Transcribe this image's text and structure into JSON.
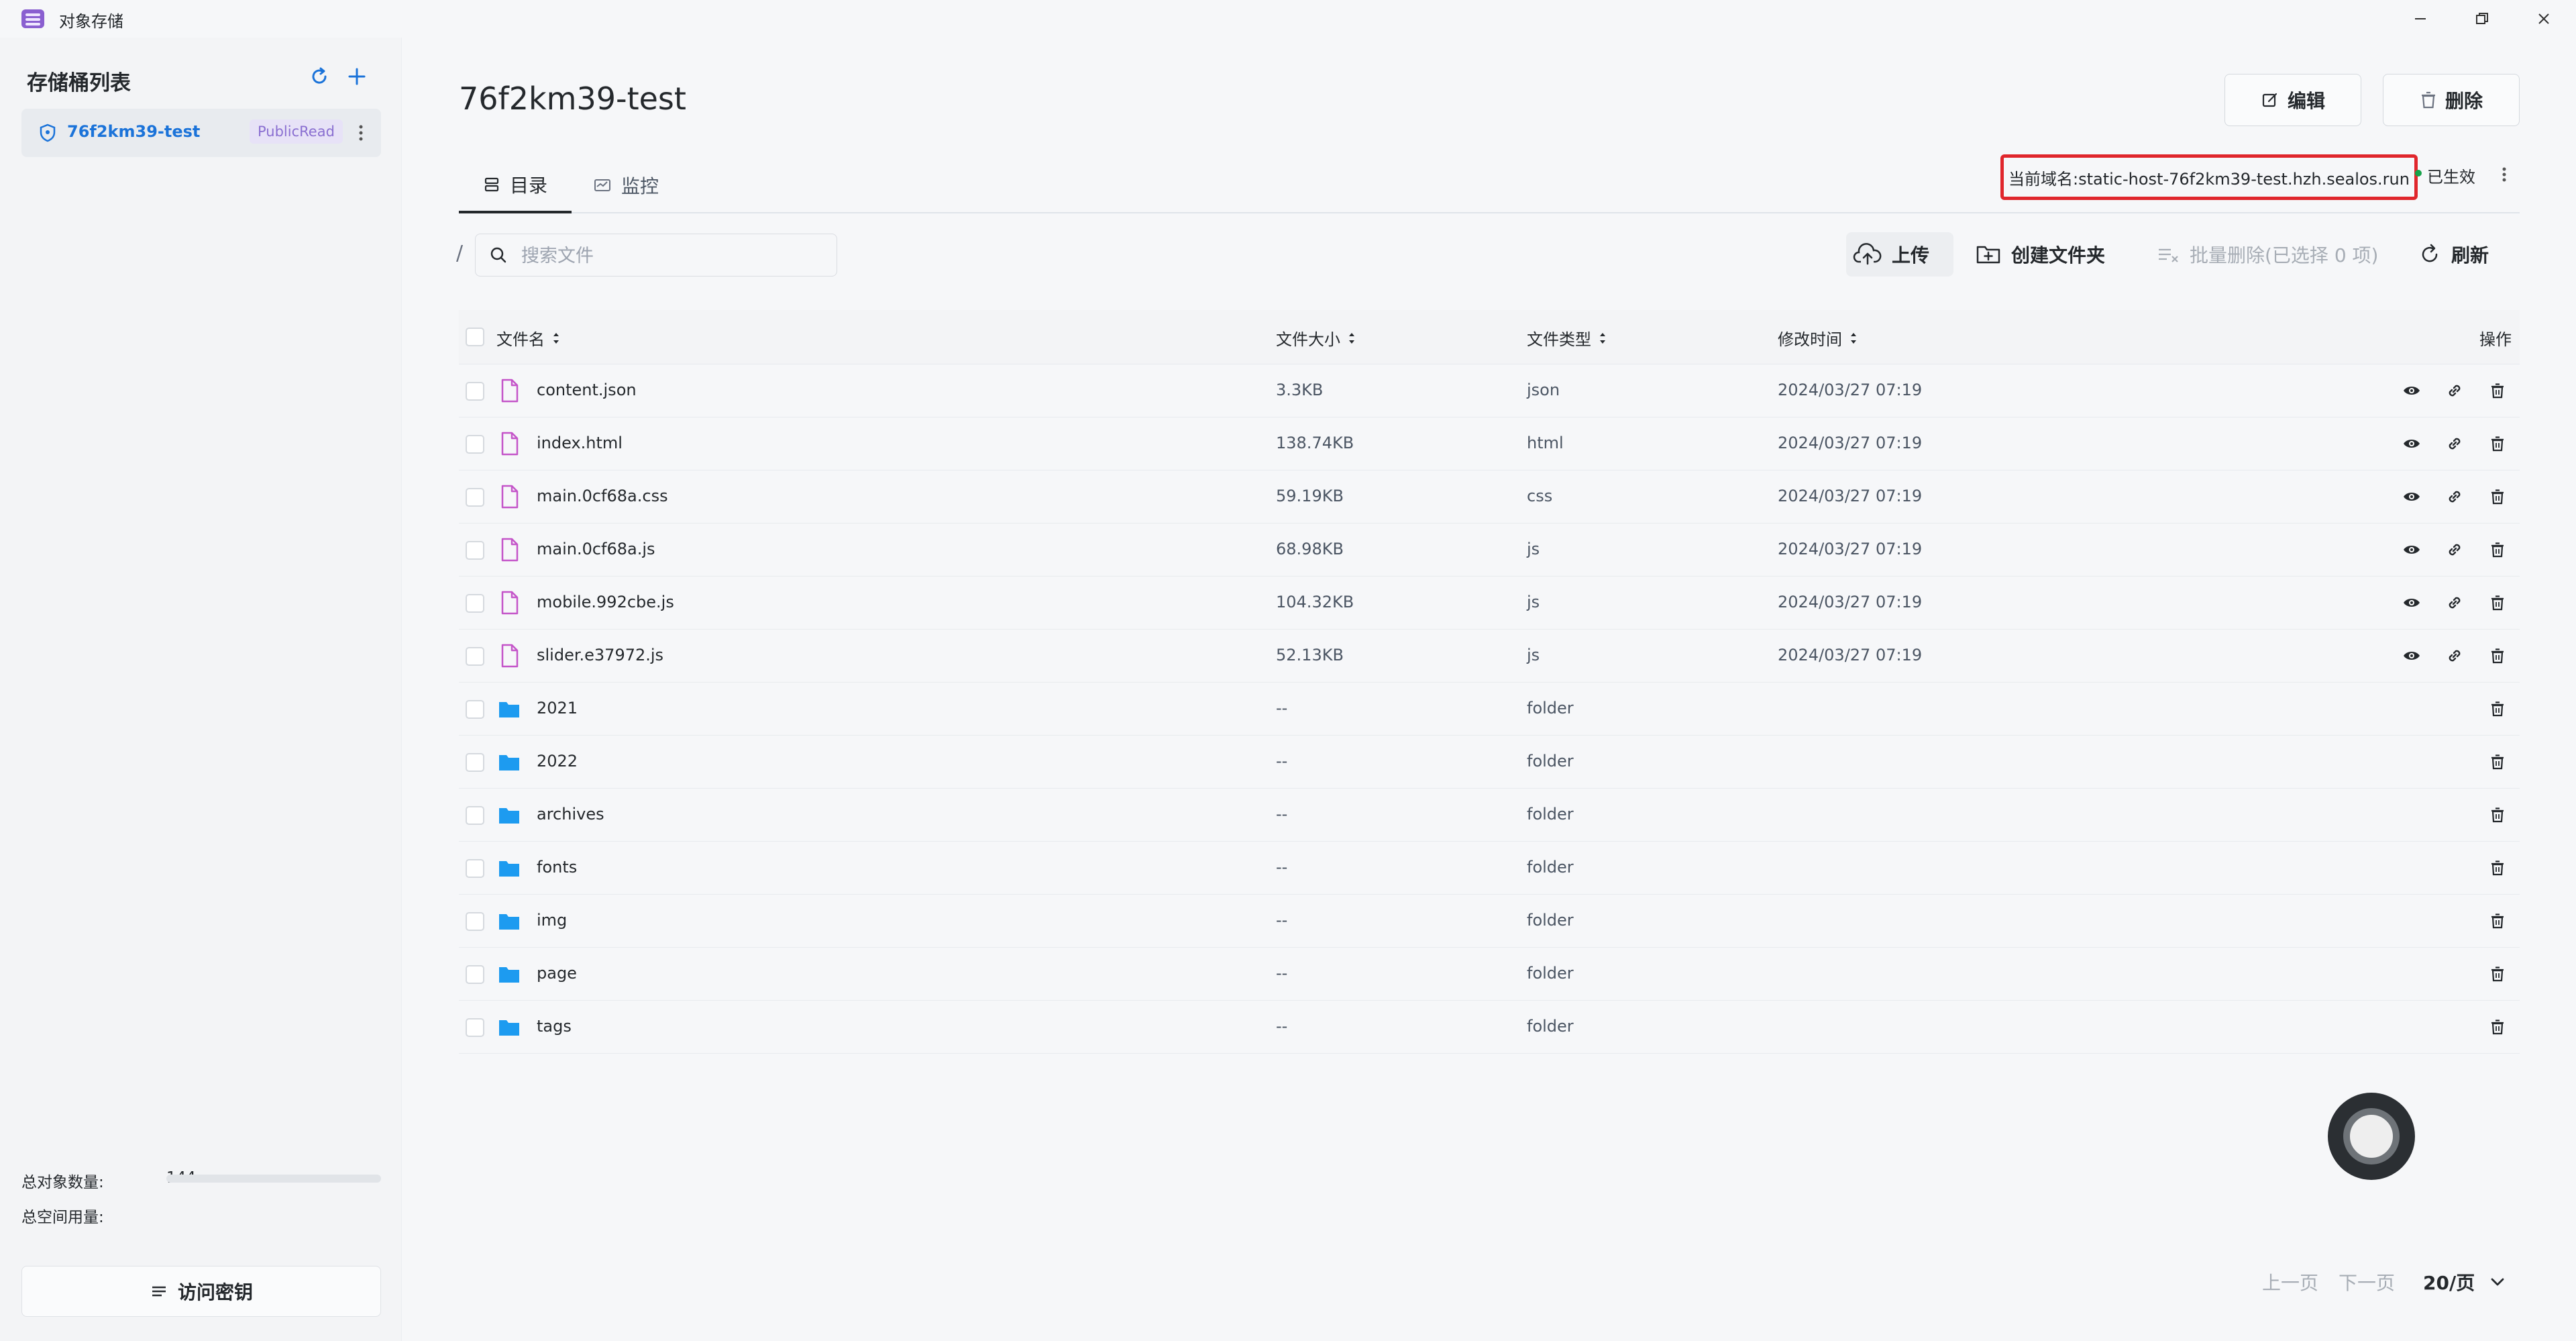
{
  "app": {
    "title": "对象存储"
  },
  "sidebar": {
    "title": "存储桶列表",
    "buckets": [
      {
        "name": "76f2km39-test",
        "policy": "PublicRead"
      }
    ],
    "stats": {
      "objects_label": "总对象数量:",
      "objects_value": "144",
      "space_label": "总空间用量:",
      "space_usage_fraction": 0
    },
    "access_key_label": "访问密钥"
  },
  "main": {
    "bucket_title": "76f2km39-test",
    "edit_label": "编辑",
    "delete_label": "删除",
    "tabs": [
      {
        "label": "目录"
      },
      {
        "label": "监控"
      }
    ],
    "domain_text": "当前域名:static-host-76f2km39-test.hzh.sealos.run",
    "domain_status": "已生效",
    "path": "/",
    "search_placeholder": "搜索文件",
    "toolbar": {
      "upload": "上传",
      "create_folder": "创建文件夹",
      "batch_delete": "批量删除(已选择 0 项)",
      "refresh": "刷新"
    },
    "columns": {
      "name": "文件名",
      "size": "文件大小",
      "type": "文件类型",
      "modified": "修改时间",
      "actions": "操作"
    },
    "files": [
      {
        "name": "content.json",
        "size": "3.3KB",
        "type": "json",
        "modified": "2024/03/27 07:19",
        "kind": "file"
      },
      {
        "name": "index.html",
        "size": "138.74KB",
        "type": "html",
        "modified": "2024/03/27 07:19",
        "kind": "file"
      },
      {
        "name": "main.0cf68a.css",
        "size": "59.19KB",
        "type": "css",
        "modified": "2024/03/27 07:19",
        "kind": "file"
      },
      {
        "name": "main.0cf68a.js",
        "size": "68.98KB",
        "type": "js",
        "modified": "2024/03/27 07:19",
        "kind": "file"
      },
      {
        "name": "mobile.992cbe.js",
        "size": "104.32KB",
        "type": "js",
        "modified": "2024/03/27 07:19",
        "kind": "file"
      },
      {
        "name": "slider.e37972.js",
        "size": "52.13KB",
        "type": "js",
        "modified": "2024/03/27 07:19",
        "kind": "file"
      },
      {
        "name": "2021",
        "size": "--",
        "type": "folder",
        "modified": "",
        "kind": "folder"
      },
      {
        "name": "2022",
        "size": "--",
        "type": "folder",
        "modified": "",
        "kind": "folder"
      },
      {
        "name": "archives",
        "size": "--",
        "type": "folder",
        "modified": "",
        "kind": "folder"
      },
      {
        "name": "fonts",
        "size": "--",
        "type": "folder",
        "modified": "",
        "kind": "folder"
      },
      {
        "name": "img",
        "size": "--",
        "type": "folder",
        "modified": "",
        "kind": "folder"
      },
      {
        "name": "page",
        "size": "--",
        "type": "folder",
        "modified": "",
        "kind": "folder"
      },
      {
        "name": "tags",
        "size": "--",
        "type": "folder",
        "modified": "",
        "kind": "folder"
      }
    ],
    "pagination": {
      "prev": "上一页",
      "next": "下一页",
      "page_size": "20/页"
    }
  },
  "colors": {
    "accent": "#1b73d9",
    "file_icon": "#c455c9",
    "folder_icon": "#1d9bf0",
    "highlight_box": "#e0262c",
    "status_dot": "#16a34a"
  }
}
